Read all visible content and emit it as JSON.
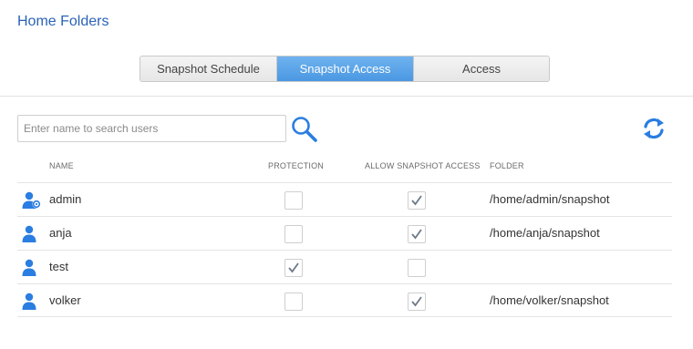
{
  "page": {
    "title": "Home Folders"
  },
  "tabs": [
    {
      "label": "Snapshot Schedule",
      "active": false
    },
    {
      "label": "Snapshot Access",
      "active": true
    },
    {
      "label": "Access",
      "active": false
    }
  ],
  "search": {
    "placeholder": "Enter name to search users",
    "value": ""
  },
  "table": {
    "headers": {
      "name": "NAME",
      "protection": "PROTECTION",
      "allow": "ALLOW SNAPSHOT ACCESS",
      "folder": "FOLDER"
    },
    "rows": [
      {
        "name": "admin",
        "icon": "admin-user-icon",
        "protection": false,
        "allow": true,
        "folder": "/home/admin/snapshot"
      },
      {
        "name": "anja",
        "icon": "user-icon",
        "protection": false,
        "allow": true,
        "folder": "/home/anja/snapshot"
      },
      {
        "name": "test",
        "icon": "user-icon",
        "protection": true,
        "allow": false,
        "folder": ""
      },
      {
        "name": "volker",
        "icon": "user-icon",
        "protection": false,
        "allow": true,
        "folder": "/home/volker/snapshot"
      }
    ]
  },
  "colors": {
    "accent": "#2a7de1",
    "title": "#2a63b8",
    "tab_active": "#5aa3e8"
  },
  "icons": {
    "search": "search-icon",
    "refresh": "refresh-icon",
    "check": "checkmark-icon"
  }
}
